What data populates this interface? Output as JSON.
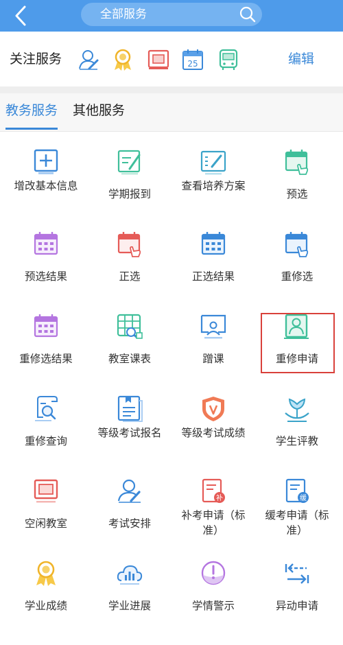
{
  "header": {
    "search_placeholder": "全部服务"
  },
  "follow": {
    "title": "关注服务",
    "icons": [
      "user-edit-icon",
      "medal-icon",
      "classroom-icon",
      "calendar-icon",
      "bus-icon"
    ],
    "calendar_day": "25",
    "edit_label": "编辑"
  },
  "tabs": [
    {
      "label": "教务服务",
      "active": true
    },
    {
      "label": "其他服务",
      "active": false
    }
  ],
  "services": [
    {
      "label": "增改基本信息",
      "icon": "add-info-icon"
    },
    {
      "label": "学期报到",
      "icon": "report-icon"
    },
    {
      "label": "查看培养方案",
      "icon": "plan-icon"
    },
    {
      "label": "预选",
      "icon": "preselect-icon"
    },
    {
      "label": "预选结果",
      "icon": "preselect-result-icon"
    },
    {
      "label": "正选",
      "icon": "select-icon"
    },
    {
      "label": "正选结果",
      "icon": "select-result-icon"
    },
    {
      "label": "重修选",
      "icon": "retake-select-icon"
    },
    {
      "label": "重修选结果",
      "icon": "retake-result-icon"
    },
    {
      "label": "教室课表",
      "icon": "classroom-schedule-icon"
    },
    {
      "label": "蹭课",
      "icon": "audit-class-icon"
    },
    {
      "label": "重修申请",
      "icon": "retake-apply-icon"
    },
    {
      "label": "重修查询",
      "icon": "retake-query-icon"
    },
    {
      "label": "等级考试报名",
      "icon": "exam-register-icon"
    },
    {
      "label": "等级考试成绩",
      "icon": "exam-score-icon"
    },
    {
      "label": "学生评教",
      "icon": "evaluation-icon"
    },
    {
      "label": "空闲教室",
      "icon": "free-classroom-icon"
    },
    {
      "label": "考试安排",
      "icon": "exam-arrange-icon"
    },
    {
      "label": "补考申请（标准）",
      "icon": "makeup-exam-icon",
      "badge": "补"
    },
    {
      "label": "缓考申请（标准）",
      "icon": "deferred-exam-icon",
      "badge": "缓"
    },
    {
      "label": "学业成绩",
      "icon": "grades-icon"
    },
    {
      "label": "学业进展",
      "icon": "progress-icon"
    },
    {
      "label": "学情警示",
      "icon": "warning-icon"
    },
    {
      "label": "异动申请",
      "icon": "status-change-icon"
    }
  ],
  "colors": {
    "header": "#4e9bea",
    "accent": "#3a88d8",
    "highlight": "#d9403a"
  }
}
